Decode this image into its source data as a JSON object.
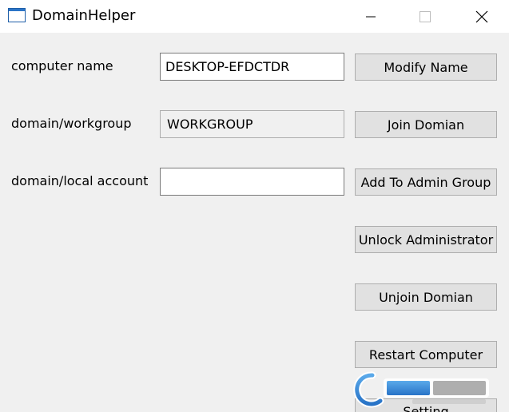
{
  "window": {
    "title": "DomainHelper",
    "controls": {
      "minimize_icon": "minimize-icon",
      "maximize_icon": "maximize-icon",
      "close_icon": "close-icon"
    }
  },
  "form": {
    "computer_name": {
      "label": "computer name",
      "value": "DESKTOP-EFDCTDR"
    },
    "domain_workgroup": {
      "label": "domain/workgroup",
      "value": "WORKGROUP"
    },
    "domain_local_account": {
      "label": "domain/local account",
      "value": ""
    }
  },
  "buttons": {
    "modify_name": "Modify Name",
    "join_domain": "Join Domian",
    "add_to_admin_group": "Add To Admin Group",
    "unlock_administrator": "Unlock Administrator",
    "unjoin_domain": "Unjoin Domian",
    "restart_computer": "Restart Computer",
    "setting": "Setting"
  },
  "colors": {
    "window_background": "#f0f0f0",
    "titlebar_background": "#ffffff",
    "button_face": "#e1e1e1",
    "button_border": "#adadad",
    "field_border": "#7a7a7a"
  }
}
